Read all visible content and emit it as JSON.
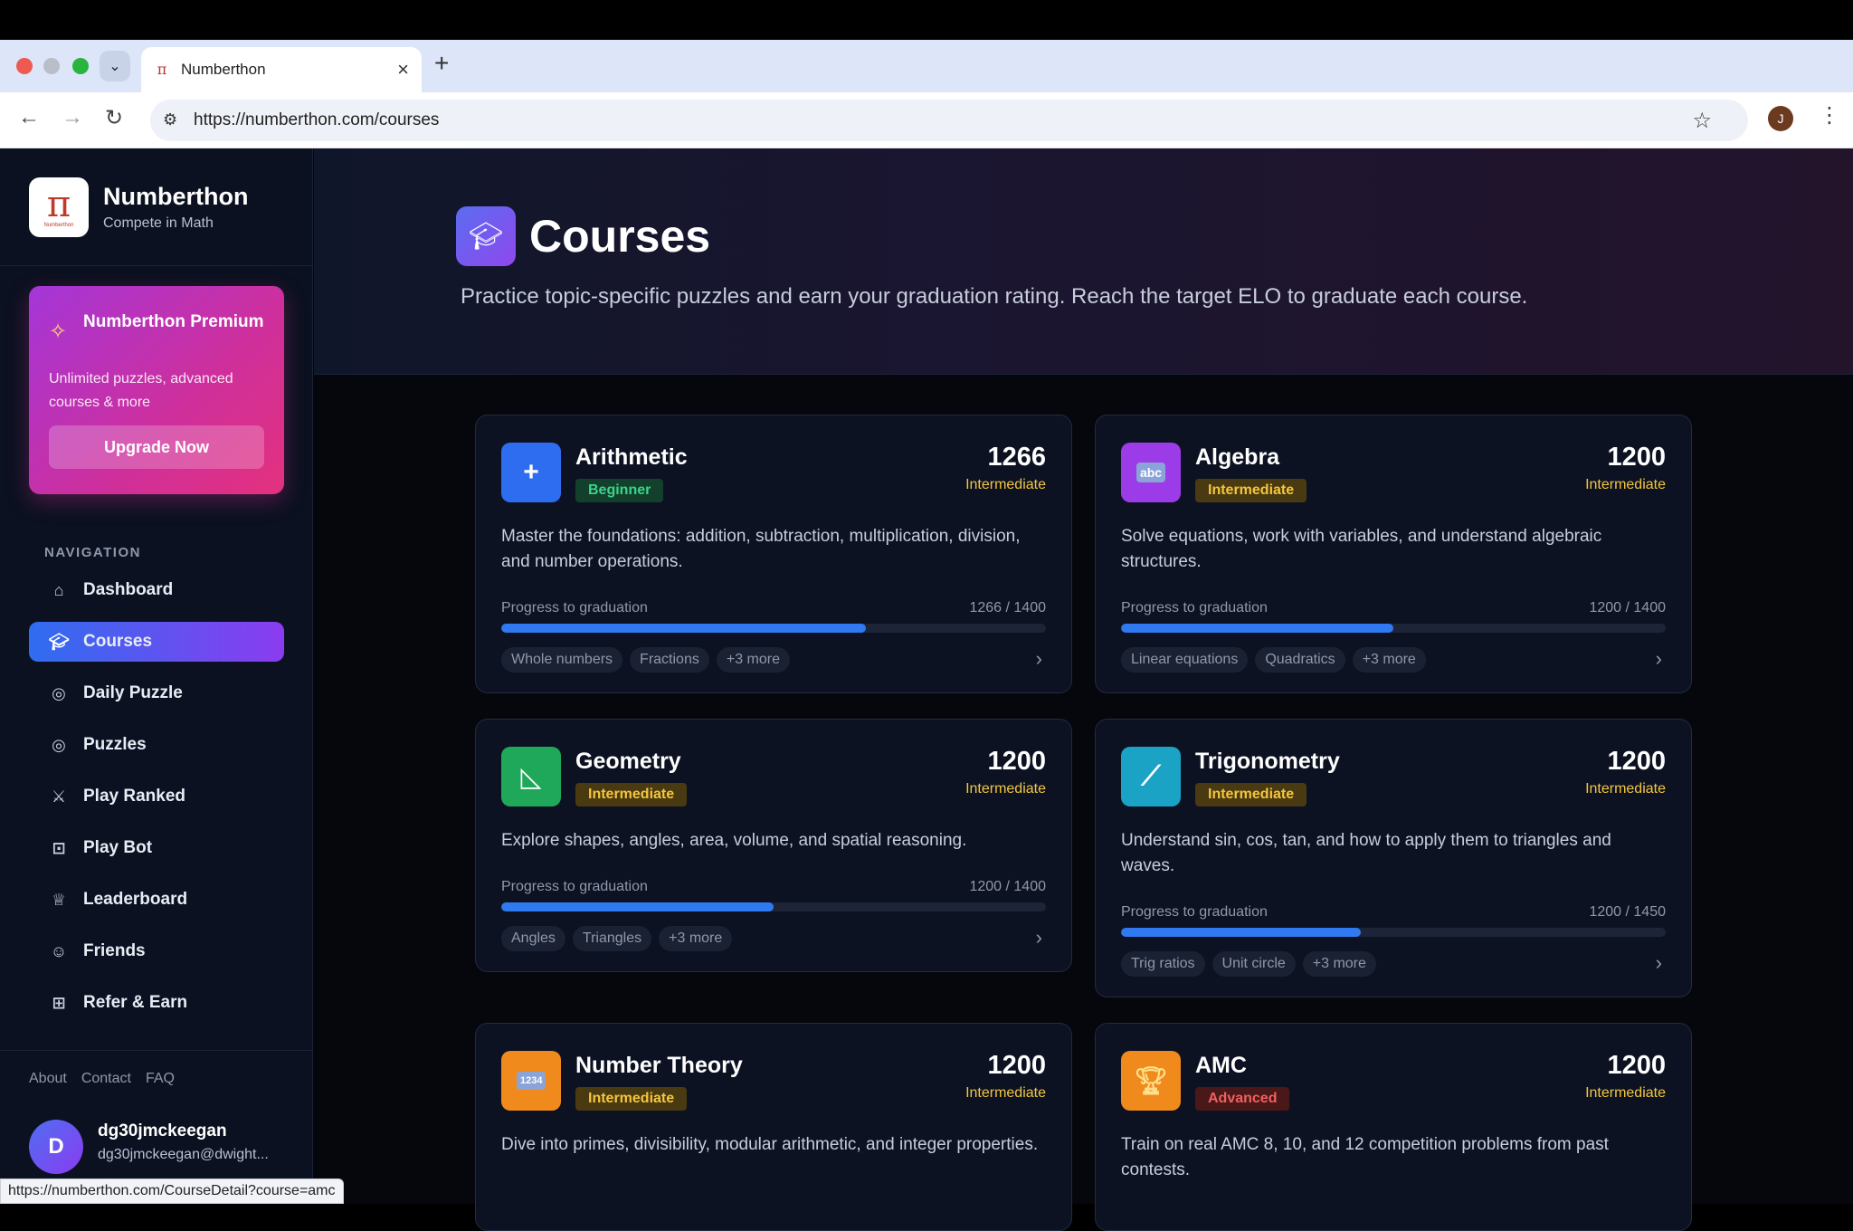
{
  "browser": {
    "tab_title": "Numberthon",
    "url": "https://numberthon.com/courses",
    "profile_initial": "J",
    "status_url": "https://numberthon.com/CourseDetail?course=amc"
  },
  "brand": {
    "name": "Numberthon",
    "tagline": "Compete in Math",
    "logo_text": "Numberthon"
  },
  "premium": {
    "title": "Numberthon Premium",
    "description": "Unlimited puzzles, advanced courses & more",
    "button": "Upgrade Now"
  },
  "nav": {
    "heading": "NAVIGATION",
    "items": [
      {
        "label": "Dashboard",
        "icon": "home-icon"
      },
      {
        "label": "Courses",
        "icon": "graduation-cap-icon",
        "active": true
      },
      {
        "label": "Daily Puzzle",
        "icon": "target-icon"
      },
      {
        "label": "Puzzles",
        "icon": "target-icon"
      },
      {
        "label": "Play Ranked",
        "icon": "swords-icon"
      },
      {
        "label": "Play Bot",
        "icon": "robot-icon"
      },
      {
        "label": "Leaderboard",
        "icon": "trophy-icon"
      },
      {
        "label": "Friends",
        "icon": "users-icon"
      },
      {
        "label": "Refer & Earn",
        "icon": "gift-icon"
      }
    ]
  },
  "footer": {
    "links": [
      "About",
      "Contact",
      "FAQ"
    ],
    "user_initial": "D",
    "username": "dg30jmckeegan",
    "email": "dg30jmckeegan@dwight..."
  },
  "hero": {
    "title": "Courses",
    "subtitle": "Practice topic-specific puzzles and earn your graduation rating. Reach the target ELO to graduate each course."
  },
  "progress_label": "Progress to graduation",
  "courses": [
    {
      "title": "Arithmetic",
      "level": "Beginner",
      "elo": "1266",
      "elo_tag": "Intermediate",
      "description": "Master the foundations: addition, subtraction, multiplication, division, and number operations.",
      "progress_text": "1266 / 1400",
      "progress": 0.67,
      "tags": [
        "Whole numbers",
        "Fractions",
        "+3 more"
      ],
      "icon": "plus-icon",
      "color": "#2f6df0"
    },
    {
      "title": "Algebra",
      "level": "Intermediate",
      "elo": "1200",
      "elo_tag": "Intermediate",
      "description": "Solve equations, work with variables, and understand algebraic structures.",
      "progress_text": "1200 / 1400",
      "progress": 0.5,
      "tags": [
        "Linear equations",
        "Quadratics",
        "+3 more"
      ],
      "icon": "abc-icon",
      "icon_text": "abc",
      "color": "#9b3ce8"
    },
    {
      "title": "Geometry",
      "level": "Intermediate",
      "elo": "1200",
      "elo_tag": "Intermediate",
      "description": "Explore shapes, angles, area, volume, and spatial reasoning.",
      "progress_text": "1200 / 1400",
      "progress": 0.5,
      "tags": [
        "Angles",
        "Triangles",
        "+3 more"
      ],
      "icon": "triangle-ruler-icon",
      "color": "#1fa85a"
    },
    {
      "title": "Trigonometry",
      "level": "Intermediate",
      "elo": "1200",
      "elo_tag": "Intermediate",
      "description": "Understand sin, cos, tan, and how to apply them to triangles and waves.",
      "progress_text": "1200 / 1450",
      "progress": 0.44,
      "tags": [
        "Trig ratios",
        "Unit circle",
        "+3 more"
      ],
      "icon": "ruler-icon",
      "color": "#1aa3c4"
    },
    {
      "title": "Number Theory",
      "level": "Intermediate",
      "elo": "1200",
      "elo_tag": "Intermediate",
      "description": "Dive into primes, divisibility, modular arithmetic, and integer properties.",
      "icon": "numbers-icon",
      "icon_text": "1234",
      "color": "#f08a1c"
    },
    {
      "title": "AMC",
      "level": "Advanced",
      "elo": "1200",
      "elo_tag": "Intermediate",
      "description": "Train on real AMC 8, 10, and 12 competition problems from past contests.",
      "icon": "trophy-icon",
      "color": "#f08a1c"
    }
  ]
}
